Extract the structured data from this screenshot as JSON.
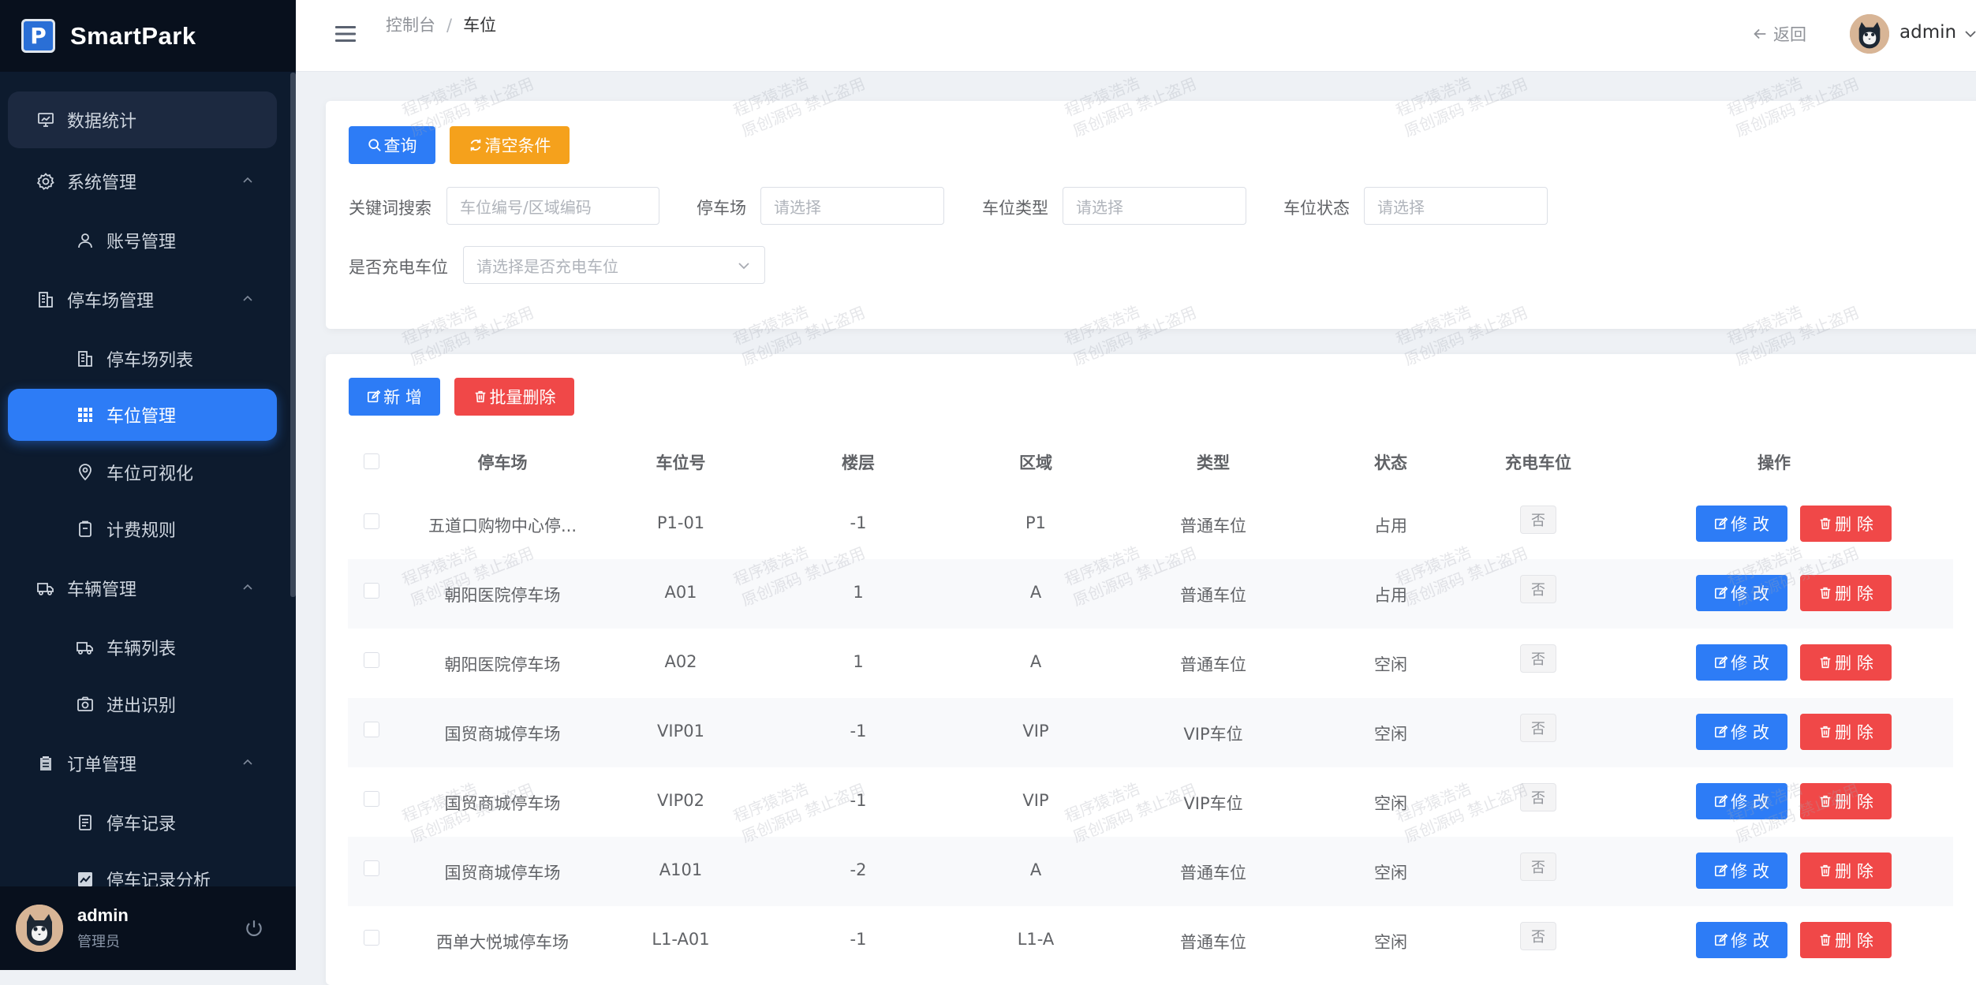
{
  "app": {
    "logo_letter": "P",
    "name": "SmartPark"
  },
  "sidebar": {
    "items": [
      {
        "label": "数据统计"
      },
      {
        "label": "系统管理"
      },
      {
        "label": "账号管理"
      },
      {
        "label": "停车场管理"
      },
      {
        "label": "停车场列表"
      },
      {
        "label": "车位管理"
      },
      {
        "label": "车位可视化"
      },
      {
        "label": "计费规则"
      },
      {
        "label": "车辆管理"
      },
      {
        "label": "车辆列表"
      },
      {
        "label": "进出识别"
      },
      {
        "label": "订单管理"
      },
      {
        "label": "停车记录"
      },
      {
        "label": "停车记录分析"
      }
    ],
    "user": {
      "name": "admin",
      "role": "管理员"
    }
  },
  "header": {
    "breadcrumb": [
      "控制台",
      "车位"
    ],
    "separator": "/",
    "back_label": "返回",
    "user": "admin"
  },
  "search": {
    "query_label": "查询",
    "clear_label": "清空条件",
    "keyword_label": "关键词搜索",
    "keyword_placeholder": "车位编号/区域编码",
    "lot_label": "停车场",
    "lot_placeholder": "请选择",
    "type_label": "车位类型",
    "type_placeholder": "请选择",
    "status_label": "车位状态",
    "status_placeholder": "请选择",
    "charging_label": "是否充电车位",
    "charging_placeholder": "请选择是否充电车位"
  },
  "toolbar": {
    "add_label": "新 增",
    "batch_delete_label": "批量删除"
  },
  "table": {
    "columns": [
      "停车场",
      "车位号",
      "楼层",
      "区域",
      "类型",
      "状态",
      "充电车位",
      "操作"
    ],
    "edit_label": "修 改",
    "delete_label": "删 除",
    "rows": [
      {
        "lot": "五道口购物中心停...",
        "spot": "P1-01",
        "floor": "-1",
        "area": "P1",
        "type": "普通车位",
        "status": "占用",
        "charging": "否"
      },
      {
        "lot": "朝阳医院停车场",
        "spot": "A01",
        "floor": "1",
        "area": "A",
        "type": "普通车位",
        "status": "占用",
        "charging": "否"
      },
      {
        "lot": "朝阳医院停车场",
        "spot": "A02",
        "floor": "1",
        "area": "A",
        "type": "普通车位",
        "status": "空闲",
        "charging": "否"
      },
      {
        "lot": "国贸商城停车场",
        "spot": "VIP01",
        "floor": "-1",
        "area": "VIP",
        "type": "VIP车位",
        "status": "空闲",
        "charging": "否"
      },
      {
        "lot": "国贸商城停车场",
        "spot": "VIP02",
        "floor": "-1",
        "area": "VIP",
        "type": "VIP车位",
        "status": "空闲",
        "charging": "否"
      },
      {
        "lot": "国贸商城停车场",
        "spot": "A101",
        "floor": "-2",
        "area": "A",
        "type": "普通车位",
        "status": "空闲",
        "charging": "否"
      },
      {
        "lot": "西单大悦城停车场",
        "spot": "L1-A01",
        "floor": "-1",
        "area": "L1-A",
        "type": "普通车位",
        "status": "空闲",
        "charging": "否"
      }
    ]
  },
  "watermark": {
    "line1": "程序猿浩浩",
    "line2": "原创源码 禁止盗用"
  },
  "colors": {
    "primary": "#2d7cf6",
    "warning": "#f5a11c",
    "danger": "#f04848",
    "sidebar_bg": "#0d1b2e"
  }
}
